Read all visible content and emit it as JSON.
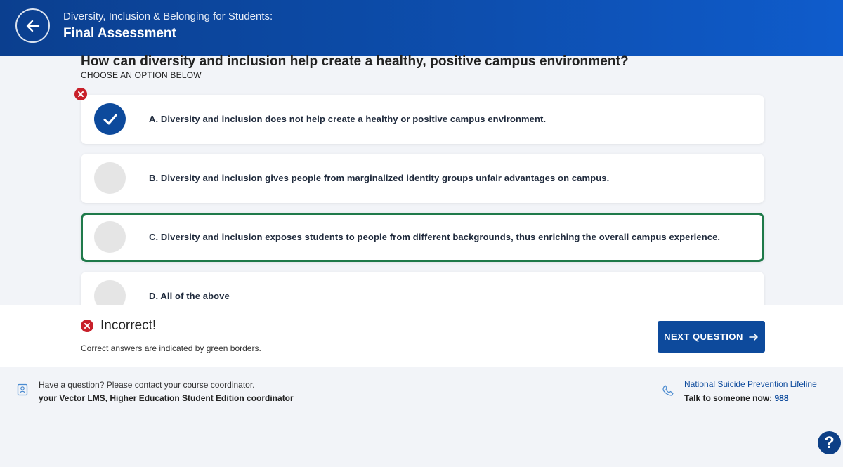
{
  "header": {
    "course": "Diversity, Inclusion & Belonging for Students:",
    "title": "Final Assessment"
  },
  "question": {
    "text": "How can diversity and inclusion help create a healthy, positive campus environment?",
    "instruction": "CHOOSE AN OPTION BELOW",
    "options": [
      {
        "label": "A. Diversity and inclusion does not help create a healthy or positive campus environment.",
        "state": "selected-incorrect"
      },
      {
        "label": "B. Diversity and inclusion gives people from marginalized identity groups unfair advantages on campus.",
        "state": "unselected"
      },
      {
        "label": "C. Diversity and inclusion exposes students to people from different backgrounds, thus enriching the overall campus experience.",
        "state": "correct"
      },
      {
        "label": "D. All of the above",
        "state": "unselected"
      }
    ]
  },
  "feedback": {
    "title": "Incorrect!",
    "text": "Correct answers are indicated by green borders.",
    "next_label": "NEXT QUESTION"
  },
  "footer": {
    "contact_question": "Have a question? Please contact your course coordinator.",
    "contact_who": "your Vector LMS, Higher Education Student Edition coordinator",
    "lifeline_link": "National Suicide Prevention Lifeline",
    "talk_text": "Talk to someone now:",
    "talk_number": "988",
    "help_label": "?"
  },
  "colors": {
    "header_blue": "#0d4fb0",
    "primary": "#0d4a9c",
    "correct_green": "#1f7a4a",
    "error_red": "#c8202a"
  }
}
